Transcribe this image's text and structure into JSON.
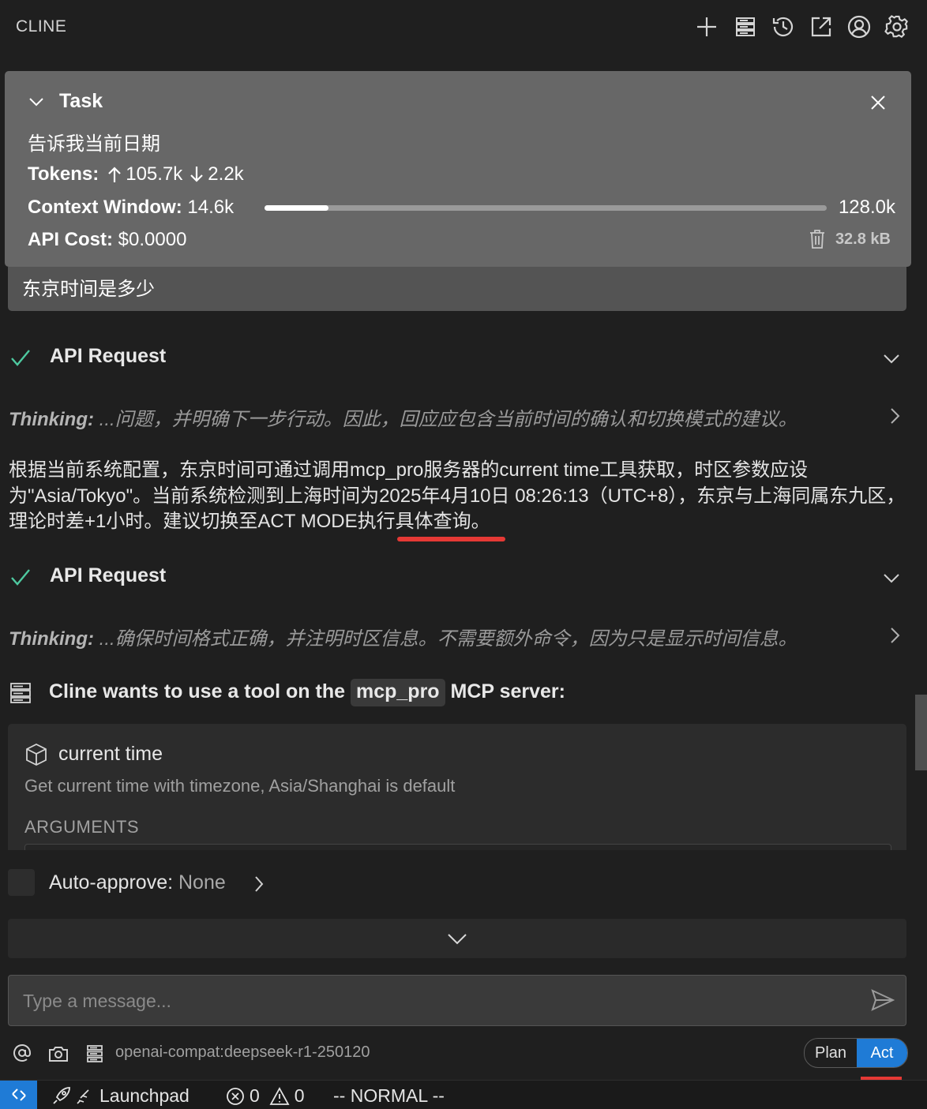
{
  "header": {
    "title": "CLINE",
    "icons": [
      "plus-icon",
      "mcp-servers-icon",
      "history-icon",
      "popout-icon",
      "account-icon",
      "settings-icon"
    ]
  },
  "task": {
    "heading": "Task",
    "text": "告诉我当前日期",
    "tokens_label": "Tokens:",
    "tokens_in": "105.7k",
    "tokens_out": "2.2k",
    "context_label": "Context Window:",
    "context_used": "14.6k",
    "context_max": "128.0k",
    "context_fraction": 0.114,
    "cost_label": "API Cost:",
    "cost_value": "$0.0000",
    "size": "32.8 kB"
  },
  "user_message": "东京时间是多少",
  "api_requests": [
    {
      "label": "API Request",
      "thinking_label": "Thinking:",
      "thinking_text": "...问题，并明确下一步行动。因此，回应应包含当前时间的确认和切换模式的建议。"
    },
    {
      "label": "API Request",
      "thinking_label": "Thinking:",
      "thinking_text": "...确保时间格式正确，并注明时区信息。不需要额外命令，因为只是显示时间信息。"
    }
  ],
  "response_text": "根据当前系统配置，东京时间可通过调用mcp_pro服务器的current time工具获取，时区参数应设为\"Asia/Tokyo\"。当前系统检测到上海时间为2025年4月10日 08:26:13（UTC+8），东京与上海同属东九区，理论时差+1小时。建议切换至ACT MODE执行具体查询。",
  "tool_use": {
    "prefix": "Cline wants to use a tool on the",
    "server": "mcp_pro",
    "suffix": "MCP server:",
    "tool_name": "current time",
    "tool_description": "Get current time with timezone, Asia/Shanghai is default",
    "arguments_label": "ARGUMENTS"
  },
  "auto_approve": {
    "label": "Auto-approve:",
    "value": "None"
  },
  "input": {
    "placeholder": "Type a message..."
  },
  "model": "openai-compat:deepseek-r1-250120",
  "mode": {
    "plan": "Plan",
    "act": "Act",
    "selected": "Act"
  },
  "statusbar": {
    "launchpad": "Launchpad",
    "errors": "0",
    "warnings": "0",
    "vim_mode": "-- NORMAL --"
  },
  "colors": {
    "accent": "#1f7bd6",
    "success": "#4ec9a0",
    "highlight": "#e53935"
  }
}
